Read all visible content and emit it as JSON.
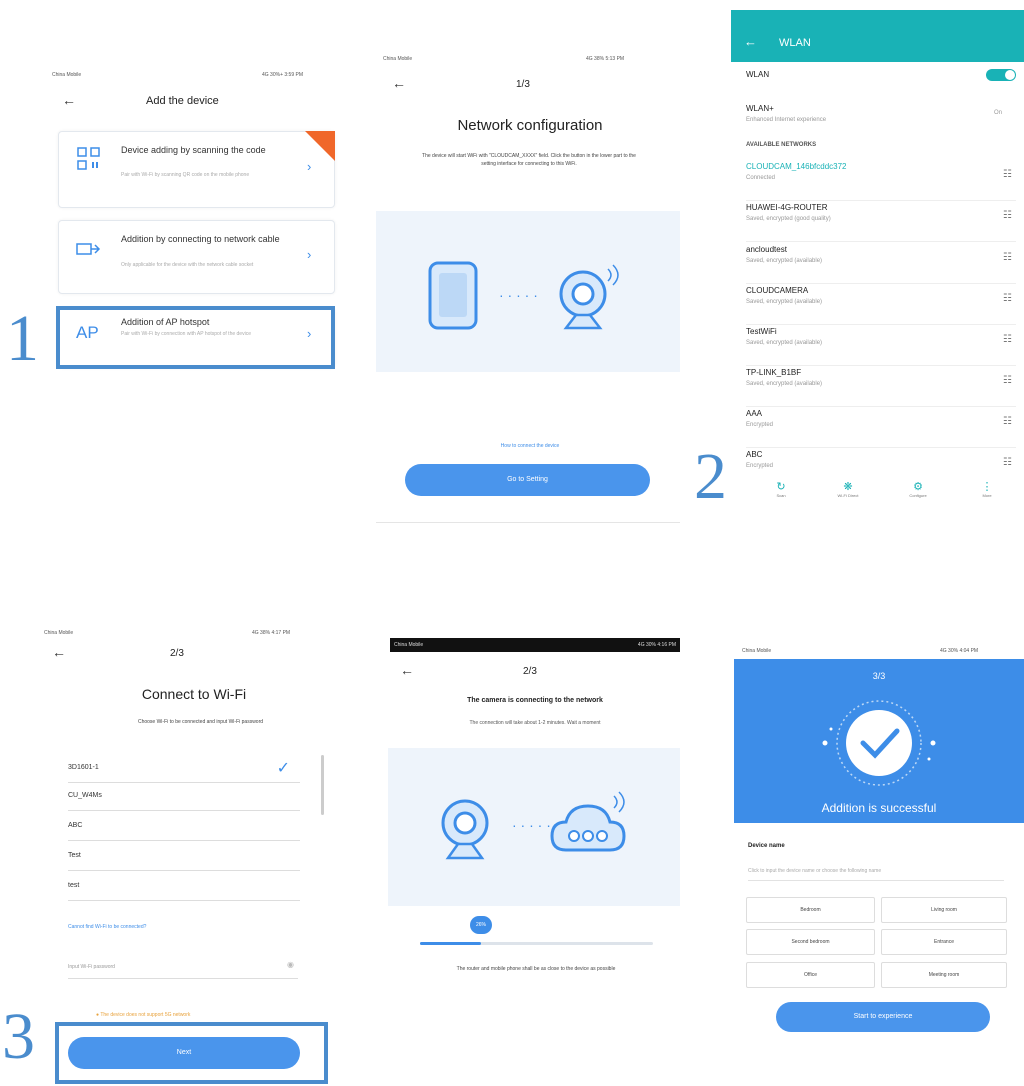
{
  "steps": {
    "s1": "1",
    "s2": "2",
    "s3": "3"
  },
  "p1": {
    "carrier": "China Mobile",
    "status_right": "4G 30%+ 3:59 PM",
    "title": "Add the device",
    "items": [
      {
        "title": "Device adding by scanning the code",
        "sub": "Pair with Wi-Fi by scanning QR code on the mobile phone",
        "icon": "qr-code-icon"
      },
      {
        "title": "Addition by connecting to network cable",
        "sub": "Only applicable for the device with the network cable socket",
        "icon": "ethernet-icon"
      },
      {
        "title": "Addition of AP hotspot",
        "sub": "Pair with Wi-Fi by connection with AP hotspot of the device",
        "icon_text": "AP"
      }
    ]
  },
  "p2": {
    "carrier": "China Mobile",
    "status_right": "4G 38% 5:13 PM",
    "step": "1/3",
    "title": "Network configuration",
    "desc": "The device will start WiFi with \"CLOUDCAM_XXXX\" field. Click the button in the lower part to the setting interface for connecting to this WiFi.",
    "link": "How to connect the device",
    "button": "Go to Setting"
  },
  "p3": {
    "title": "WLAN",
    "wlan_label": "WLAN",
    "wlan_plus": "WLAN+",
    "wlan_plus_sub": "Enhanced Internet experience",
    "wlan_plus_val": "On",
    "section": "AVAILABLE NETWORKS",
    "networks": [
      {
        "name": "CLOUDCAM_146bfcddc372",
        "status": "Connected"
      },
      {
        "name": "HUAWEI-4G-ROUTER",
        "status": "Saved, encrypted (good quality)"
      },
      {
        "name": "ancloudtest",
        "status": "Saved, encrypted (available)"
      },
      {
        "name": "CLOUDCAMERA",
        "status": "Saved, encrypted (available)"
      },
      {
        "name": "TestWiFi",
        "status": "Saved, encrypted (available)"
      },
      {
        "name": "TP-LINK_B1BF",
        "status": "Saved, encrypted (available)"
      },
      {
        "name": "AAA",
        "status": "Encrypted"
      },
      {
        "name": "ABC",
        "status": "Encrypted"
      }
    ],
    "bottom": [
      "Scan",
      "Wi-Fi Direct",
      "Configure",
      "More"
    ]
  },
  "p4": {
    "carrier": "China Mobile",
    "status_right": "4G 38% 4:17 PM",
    "step": "2/3",
    "title": "Connect to Wi-Fi",
    "desc": "Choose Wi-Fi to be connected and input Wi-Fi password",
    "networks": [
      "3D1601-1",
      "CU_W4Ms",
      "ABC",
      "Test",
      "test"
    ],
    "cant_find": "Cannot find Wi-Fi to be connected?",
    "pw_placeholder": "Input Wi-Fi password",
    "note": "The device does not support 5G network",
    "button": "Next"
  },
  "p5": {
    "carrier": "China Mobile",
    "status_right": "4G 30% 4:16 PM",
    "step": "2/3",
    "title": "The camera is connecting to the network",
    "desc": "The connection will take about 1-2 minutes. Wait a moment",
    "progress_label": "26%",
    "progress": 0.26,
    "note": "The router and mobile phone shall be as close to the device as possible"
  },
  "p6": {
    "carrier": "China Mobile",
    "status_right": "4G 30% 4:04 PM",
    "step": "3/3",
    "success": "Addition is successful",
    "device_name_label": "Device name",
    "hint": "Click to input the device name or choose the following name",
    "rooms": [
      "Bedroom",
      "Living room",
      "Second bedroom",
      "Entrance",
      "Office",
      "Meeting room"
    ],
    "button": "Start to experience"
  },
  "colors": {
    "accent": "#4a95ec",
    "highlight": "#4a8ccd",
    "teal": "#19b2b6",
    "success_bg": "#3d8de8"
  }
}
